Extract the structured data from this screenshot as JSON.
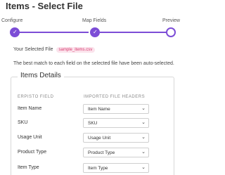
{
  "page": {
    "title": "Items - Select File"
  },
  "wizard": {
    "steps": [
      {
        "label": "Configure",
        "state": "complete"
      },
      {
        "label": "Map Fields",
        "state": "complete"
      },
      {
        "label": "Preview",
        "state": "current"
      }
    ],
    "accent_color": "#7c4dd6"
  },
  "file": {
    "label": "Your Selected File",
    "name": "sample_items.csv"
  },
  "notice": "The best match to each field on the selected file have been auto-selected.",
  "details": {
    "title": "Items Details",
    "col_left": "ERPISTO FIELD",
    "col_right": "IMPORTED FILE HEADERS",
    "rows": [
      {
        "label": "Item Name",
        "value": "Item Name"
      },
      {
        "label": "SKU",
        "value": "SKU"
      },
      {
        "label": "Usage Unit",
        "value": "Usage Unit"
      },
      {
        "label": "Product Type",
        "value": "Product Type"
      },
      {
        "label": "Item Type",
        "value": "Item Type"
      }
    ]
  },
  "icons": {
    "check": "checkmark-icon",
    "chevron": "chevron-down-icon"
  }
}
